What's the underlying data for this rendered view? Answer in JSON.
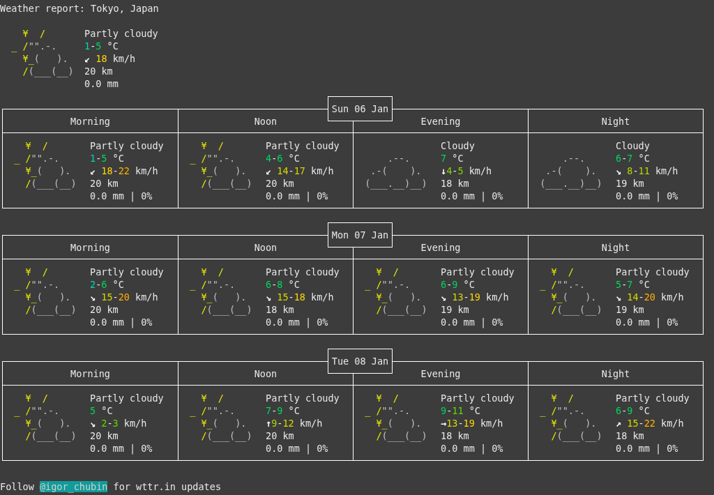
{
  "title": "Weather report: Tokyo, Japan",
  "current": {
    "icon": [
      [
        {
          "t": "    ¥  /",
          "kind": "sun"
        }
      ],
      [
        {
          "t": "  _ /",
          "kind": "sun"
        },
        {
          "t": "\"\".-.",
          "kind": "cloud"
        }
      ],
      [
        {
          "t": "    ¥_",
          "kind": "sun"
        },
        {
          "t": "(   ).",
          "kind": "cloud"
        }
      ],
      [
        {
          "t": "    /",
          "kind": "sun"
        },
        {
          "t": "(___(__)",
          "kind": "cloud"
        }
      ]
    ],
    "condition": "Partly cloudy",
    "temperature": [
      {
        "t": "1",
        "color": "#00d7af"
      },
      {
        "t": "-"
      },
      {
        "t": "5",
        "color": "#00d75f"
      },
      {
        "t": " °C"
      }
    ],
    "wind": [
      {
        "t": "↙ ",
        "kind": "arrow"
      },
      {
        "t": "18",
        "color": "#ffd700"
      },
      {
        "t": " km/h"
      }
    ],
    "visibility": "20 km",
    "precipitation": "0.0 mm"
  },
  "days": [
    {
      "date": "Sun 06 Jan",
      "periods": [
        {
          "name": "Morning",
          "icon": [
            [
              {
                "t": "   ¥  /",
                "kind": "sun"
              }
            ],
            [
              {
                "t": " _ /",
                "kind": "sun"
              },
              {
                "t": "\"\".-.",
                "kind": "cloud"
              }
            ],
            [
              {
                "t": "   ¥_",
                "kind": "sun"
              },
              {
                "t": "(   ).",
                "kind": "cloud"
              }
            ],
            [
              {
                "t": "   /",
                "kind": "sun"
              },
              {
                "t": "(___(__)",
                "kind": "cloud"
              }
            ]
          ],
          "condition": "Partly cloudy",
          "temperature": [
            {
              "t": "1",
              "color": "#00d7af"
            },
            {
              "t": "-"
            },
            {
              "t": "5",
              "color": "#00d75f"
            },
            {
              "t": " °C"
            }
          ],
          "wind": [
            {
              "t": "↙ ",
              "kind": "arrow"
            },
            {
              "t": "18",
              "color": "#ffd700"
            },
            {
              "t": "-"
            },
            {
              "t": "22",
              "color": "#ffaf00"
            },
            {
              "t": " km/h"
            }
          ],
          "visibility": "20 km",
          "precipitation": "0.0 mm | 0%"
        },
        {
          "name": "Noon",
          "icon": [
            [
              {
                "t": "   ¥  /",
                "kind": "sun"
              }
            ],
            [
              {
                "t": " _ /",
                "kind": "sun"
              },
              {
                "t": "\"\".-.",
                "kind": "cloud"
              }
            ],
            [
              {
                "t": "   ¥_",
                "kind": "sun"
              },
              {
                "t": "(   ).",
                "kind": "cloud"
              }
            ],
            [
              {
                "t": "   /",
                "kind": "sun"
              },
              {
                "t": "(___(__)",
                "kind": "cloud"
              }
            ]
          ],
          "condition": "Partly cloudy",
          "temperature": [
            {
              "t": "4",
              "color": "#00d75f"
            },
            {
              "t": "-"
            },
            {
              "t": "6",
              "color": "#00d75f"
            },
            {
              "t": " °C"
            }
          ],
          "wind": [
            {
              "t": "↙ ",
              "kind": "arrow"
            },
            {
              "t": "14",
              "color": "#d7d700"
            },
            {
              "t": "-"
            },
            {
              "t": "17",
              "color": "#d7d700"
            },
            {
              "t": " km/h"
            }
          ],
          "visibility": "20 km",
          "precipitation": "0.0 mm | 0%"
        },
        {
          "name": "Evening",
          "icon": [
            [
              {
                "t": "     .--.",
                "kind": "cloud"
              }
            ],
            [
              {
                "t": "  .-(    ).",
                "kind": "cloud"
              }
            ],
            [
              {
                "t": " (___.__)__)",
                "kind": "cloud"
              }
            ]
          ],
          "condition": "Cloudy",
          "temperature": [
            {
              "t": "7",
              "color": "#00d75f"
            },
            {
              "t": " °C"
            }
          ],
          "wind": [
            {
              "t": "↓",
              "kind": "arrow"
            },
            {
              "t": "4",
              "color": "#87d700"
            },
            {
              "t": "-"
            },
            {
              "t": "5",
              "color": "#87d700"
            },
            {
              "t": " km/h"
            }
          ],
          "visibility": "18 km",
          "precipitation": "0.0 mm | 0%"
        },
        {
          "name": "Night",
          "icon": [
            [
              {
                "t": "     .--.",
                "kind": "cloud"
              }
            ],
            [
              {
                "t": "  .-(    ).",
                "kind": "cloud"
              }
            ],
            [
              {
                "t": " (___.__)__)",
                "kind": "cloud"
              }
            ]
          ],
          "condition": "Cloudy",
          "temperature": [
            {
              "t": "6",
              "color": "#00d75f"
            },
            {
              "t": "-"
            },
            {
              "t": "7",
              "color": "#00d75f"
            },
            {
              "t": " °C"
            }
          ],
          "wind": [
            {
              "t": "↘ ",
              "kind": "arrow"
            },
            {
              "t": "8",
              "color": "#afd700"
            },
            {
              "t": "-"
            },
            {
              "t": "11",
              "color": "#afd700"
            },
            {
              "t": " km/h"
            }
          ],
          "visibility": "19 km",
          "precipitation": "0.0 mm | 0%"
        }
      ]
    },
    {
      "date": "Mon 07 Jan",
      "periods": [
        {
          "name": "Morning",
          "icon": [
            [
              {
                "t": "   ¥  /",
                "kind": "sun"
              }
            ],
            [
              {
                "t": " _ /",
                "kind": "sun"
              },
              {
                "t": "\"\".-.",
                "kind": "cloud"
              }
            ],
            [
              {
                "t": "   ¥_",
                "kind": "sun"
              },
              {
                "t": "(   ).",
                "kind": "cloud"
              }
            ],
            [
              {
                "t": "   /",
                "kind": "sun"
              },
              {
                "t": "(___(__)",
                "kind": "cloud"
              }
            ]
          ],
          "condition": "Partly cloudy",
          "temperature": [
            {
              "t": "2",
              "color": "#00d7af"
            },
            {
              "t": "-"
            },
            {
              "t": "6",
              "color": "#00d75f"
            },
            {
              "t": " °C"
            }
          ],
          "wind": [
            {
              "t": "↘ ",
              "kind": "arrow"
            },
            {
              "t": "15",
              "color": "#d7d700"
            },
            {
              "t": "-"
            },
            {
              "t": "20",
              "color": "#ffaf00"
            },
            {
              "t": " km/h"
            }
          ],
          "visibility": "20 km",
          "precipitation": "0.0 mm | 0%"
        },
        {
          "name": "Noon",
          "icon": [
            [
              {
                "t": "   ¥  /",
                "kind": "sun"
              }
            ],
            [
              {
                "t": " _ /",
                "kind": "sun"
              },
              {
                "t": "\"\".-.",
                "kind": "cloud"
              }
            ],
            [
              {
                "t": "   ¥_",
                "kind": "sun"
              },
              {
                "t": "(   ).",
                "kind": "cloud"
              }
            ],
            [
              {
                "t": "   /",
                "kind": "sun"
              },
              {
                "t": "(___(__)",
                "kind": "cloud"
              }
            ]
          ],
          "condition": "Partly cloudy",
          "temperature": [
            {
              "t": "6",
              "color": "#00d75f"
            },
            {
              "t": "-"
            },
            {
              "t": "8",
              "color": "#00d75f"
            },
            {
              "t": " °C"
            }
          ],
          "wind": [
            {
              "t": "↘ ",
              "kind": "arrow"
            },
            {
              "t": "15",
              "color": "#d7d700"
            },
            {
              "t": "-"
            },
            {
              "t": "18",
              "color": "#ffd700"
            },
            {
              "t": " km/h"
            }
          ],
          "visibility": "18 km",
          "precipitation": "0.0 mm | 0%"
        },
        {
          "name": "Evening",
          "icon": [
            [
              {
                "t": "   ¥  /",
                "kind": "sun"
              }
            ],
            [
              {
                "t": " _ /",
                "kind": "sun"
              },
              {
                "t": "\"\".-.",
                "kind": "cloud"
              }
            ],
            [
              {
                "t": "   ¥_",
                "kind": "sun"
              },
              {
                "t": "(   ).",
                "kind": "cloud"
              }
            ],
            [
              {
                "t": "   /",
                "kind": "sun"
              },
              {
                "t": "(___(__)",
                "kind": "cloud"
              }
            ]
          ],
          "condition": "Partly cloudy",
          "temperature": [
            {
              "t": "6",
              "color": "#00d75f"
            },
            {
              "t": "-"
            },
            {
              "t": "9",
              "color": "#00d75f"
            },
            {
              "t": " °C"
            }
          ],
          "wind": [
            {
              "t": "↘ ",
              "kind": "arrow"
            },
            {
              "t": "13",
              "color": "#d7d700"
            },
            {
              "t": "-"
            },
            {
              "t": "19",
              "color": "#ffd700"
            },
            {
              "t": " km/h"
            }
          ],
          "visibility": "19 km",
          "precipitation": "0.0 mm | 0%"
        },
        {
          "name": "Night",
          "icon": [
            [
              {
                "t": "   ¥  /",
                "kind": "sun"
              }
            ],
            [
              {
                "t": " _ /",
                "kind": "sun"
              },
              {
                "t": "\"\".-.",
                "kind": "cloud"
              }
            ],
            [
              {
                "t": "   ¥_",
                "kind": "sun"
              },
              {
                "t": "(   ).",
                "kind": "cloud"
              }
            ],
            [
              {
                "t": "   /",
                "kind": "sun"
              },
              {
                "t": "(___(__)",
                "kind": "cloud"
              }
            ]
          ],
          "condition": "Partly cloudy",
          "temperature": [
            {
              "t": "5",
              "color": "#00d75f"
            },
            {
              "t": "-"
            },
            {
              "t": "7",
              "color": "#00d75f"
            },
            {
              "t": " °C"
            }
          ],
          "wind": [
            {
              "t": "↘ ",
              "kind": "arrow"
            },
            {
              "t": "14",
              "color": "#d7d700"
            },
            {
              "t": "-"
            },
            {
              "t": "20",
              "color": "#ffaf00"
            },
            {
              "t": " km/h"
            }
          ],
          "visibility": "19 km",
          "precipitation": "0.0 mm | 0%"
        }
      ]
    },
    {
      "date": "Tue 08 Jan",
      "periods": [
        {
          "name": "Morning",
          "icon": [
            [
              {
                "t": "   ¥  /",
                "kind": "sun"
              }
            ],
            [
              {
                "t": " _ /",
                "kind": "sun"
              },
              {
                "t": "\"\".-.",
                "kind": "cloud"
              }
            ],
            [
              {
                "t": "   ¥_",
                "kind": "sun"
              },
              {
                "t": "(   ).",
                "kind": "cloud"
              }
            ],
            [
              {
                "t": "   /",
                "kind": "sun"
              },
              {
                "t": "(___(__)",
                "kind": "cloud"
              }
            ]
          ],
          "condition": "Partly cloudy",
          "temperature": [
            {
              "t": "5",
              "color": "#00d75f"
            },
            {
              "t": " °C"
            }
          ],
          "wind": [
            {
              "t": "↘ ",
              "kind": "arrow"
            },
            {
              "t": "2",
              "color": "#5fd700"
            },
            {
              "t": "-"
            },
            {
              "t": "3",
              "color": "#5fd700"
            },
            {
              "t": " km/h"
            }
          ],
          "visibility": "20 km",
          "precipitation": "0.0 mm | 0%"
        },
        {
          "name": "Noon",
          "icon": [
            [
              {
                "t": "   ¥  /",
                "kind": "sun"
              }
            ],
            [
              {
                "t": " _ /",
                "kind": "sun"
              },
              {
                "t": "\"\".-.",
                "kind": "cloud"
              }
            ],
            [
              {
                "t": "   ¥_",
                "kind": "sun"
              },
              {
                "t": "(   ).",
                "kind": "cloud"
              }
            ],
            [
              {
                "t": "   /",
                "kind": "sun"
              },
              {
                "t": "(___(__)",
                "kind": "cloud"
              }
            ]
          ],
          "condition": "Partly cloudy",
          "temperature": [
            {
              "t": "7",
              "color": "#00d75f"
            },
            {
              "t": "-"
            },
            {
              "t": "9",
              "color": "#00d75f"
            },
            {
              "t": " °C"
            }
          ],
          "wind": [
            {
              "t": "↑",
              "kind": "arrow"
            },
            {
              "t": "9",
              "color": "#afd700"
            },
            {
              "t": "-"
            },
            {
              "t": "12",
              "color": "#d7d700"
            },
            {
              "t": " km/h"
            }
          ],
          "visibility": "20 km",
          "precipitation": "0.0 mm | 0%"
        },
        {
          "name": "Evening",
          "icon": [
            [
              {
                "t": "   ¥  /",
                "kind": "sun"
              }
            ],
            [
              {
                "t": " _ /",
                "kind": "sun"
              },
              {
                "t": "\"\".-.",
                "kind": "cloud"
              }
            ],
            [
              {
                "t": "   ¥_",
                "kind": "sun"
              },
              {
                "t": "(   ).",
                "kind": "cloud"
              }
            ],
            [
              {
                "t": "   /",
                "kind": "sun"
              },
              {
                "t": "(___(__)",
                "kind": "cloud"
              }
            ]
          ],
          "condition": "Partly cloudy",
          "temperature": [
            {
              "t": "9",
              "color": "#00d75f"
            },
            {
              "t": "-"
            },
            {
              "t": "11",
              "color": "#5fd700"
            },
            {
              "t": " °C"
            }
          ],
          "wind": [
            {
              "t": "→",
              "kind": "arrow"
            },
            {
              "t": "13",
              "color": "#d7d700"
            },
            {
              "t": "-"
            },
            {
              "t": "19",
              "color": "#ffd700"
            },
            {
              "t": " km/h"
            }
          ],
          "visibility": "18 km",
          "precipitation": "0.0 mm | 0%"
        },
        {
          "name": "Night",
          "icon": [
            [
              {
                "t": "   ¥  /",
                "kind": "sun"
              }
            ],
            [
              {
                "t": " _ /",
                "kind": "sun"
              },
              {
                "t": "\"\".-.",
                "kind": "cloud"
              }
            ],
            [
              {
                "t": "   ¥_",
                "kind": "sun"
              },
              {
                "t": "(   ).",
                "kind": "cloud"
              }
            ],
            [
              {
                "t": "   /",
                "kind": "sun"
              },
              {
                "t": "(___(__)",
                "kind": "cloud"
              }
            ]
          ],
          "condition": "Partly cloudy",
          "temperature": [
            {
              "t": "6",
              "color": "#00d75f"
            },
            {
              "t": "-"
            },
            {
              "t": "9",
              "color": "#00d75f"
            },
            {
              "t": " °C"
            }
          ],
          "wind": [
            {
              "t": "↗ ",
              "kind": "arrow"
            },
            {
              "t": "15",
              "color": "#d7d700"
            },
            {
              "t": "-"
            },
            {
              "t": "22",
              "color": "#ffaf00"
            },
            {
              "t": " km/h"
            }
          ],
          "visibility": "18 km",
          "precipitation": "0.0 mm | 0%"
        }
      ]
    }
  ],
  "footer": [
    {
      "t": "Follow "
    },
    {
      "t": "@igor_chubin",
      "kind": "link"
    },
    {
      "t": " for wttr.in updates"
    }
  ]
}
